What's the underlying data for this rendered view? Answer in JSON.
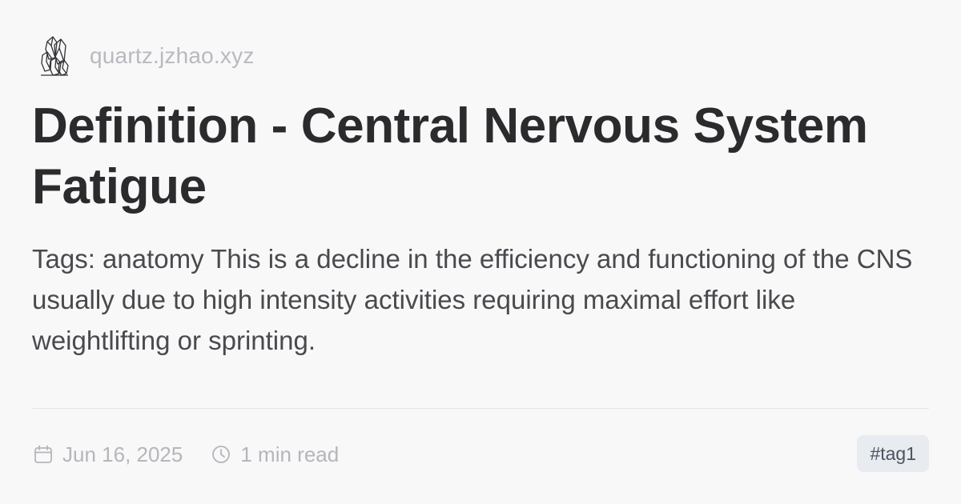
{
  "site": {
    "icon": "crystal-logo-icon",
    "name": "quartz.jzhao.xyz"
  },
  "article": {
    "title": "Definition - Central Nervous System Fatigue",
    "description": "Tags: anatomy This is a decline in the efficiency and functioning of the CNS usually due to high intensity activities requiring maximal effort like weightlifting or sprinting."
  },
  "meta": {
    "date_icon": "calendar-icon",
    "date": "Jun 16, 2025",
    "read_icon": "clock-icon",
    "read_time": "1 min read"
  },
  "tags": [
    {
      "label": "#tag1"
    }
  ],
  "colors": {
    "background": "#f8f8f9",
    "title": "#2b2b2e",
    "muted": "#b5b5bb",
    "tag_background": "#e8ebef"
  }
}
